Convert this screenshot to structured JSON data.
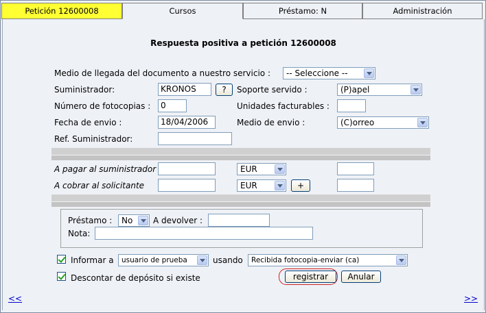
{
  "tabs": [
    {
      "label": "Petición 12600008",
      "active": true
    },
    {
      "label": "Cursos",
      "active": false
    },
    {
      "label": "Préstamo: N",
      "active": false
    },
    {
      "label": "Administración",
      "active": false
    }
  ],
  "page_title": "Respuesta positiva a petición 12600008",
  "form": {
    "medio_llegada_label": "Medio de llegada del documento a nuestro servicio :",
    "medio_llegada_value": "-- Seleccione --",
    "suministrador_label": "Suministrador:",
    "suministrador_value": "KRONOS",
    "help_button": "?",
    "soporte_label": "Soporte servido :",
    "soporte_value": "(P)apel",
    "fotocopias_label": "Número de fotocopias :",
    "fotocopias_value": "0",
    "unidades_label": "Unidades facturables :",
    "unidades_value": "",
    "fecha_label": "Fecha de envio :",
    "fecha_value": "18/04/2006",
    "medio_envio_label": "Medio de envio :",
    "medio_envio_value": "(C)orreo",
    "ref_label": "Ref. Suministrador:",
    "ref_value": ""
  },
  "payments": {
    "pagar_label": "A pagar al suministrador",
    "pagar_amount": "",
    "pagar_currency": "EUR",
    "pagar_extra": "",
    "cobrar_label": "A cobrar al solicitante",
    "cobrar_amount": "",
    "cobrar_currency": "EUR",
    "add_button": "+",
    "cobrar_extra": ""
  },
  "loan": {
    "prestamo_label": "Préstamo :",
    "prestamo_value": "No",
    "devolver_label": "A devolver :",
    "devolver_value": "",
    "nota_label": "Nota:",
    "nota_value": ""
  },
  "notify": {
    "informar_label": "Informar a",
    "informar_checked": true,
    "recipient_value": "usuario de prueba",
    "usando_label": "usando",
    "template_value": "Recibida fotocopia-enviar (ca)",
    "descontar_label": "Descontar de depósito si existe",
    "descontar_checked": true
  },
  "actions": {
    "registrar": "registrar",
    "anular": "Anular"
  },
  "nav": {
    "prev": "<<",
    "next": ">>"
  },
  "colors": {
    "active_tab": "#ffff33",
    "background": "#eef1f6",
    "highlight_ring": "#d02020",
    "check": "#21a121"
  }
}
